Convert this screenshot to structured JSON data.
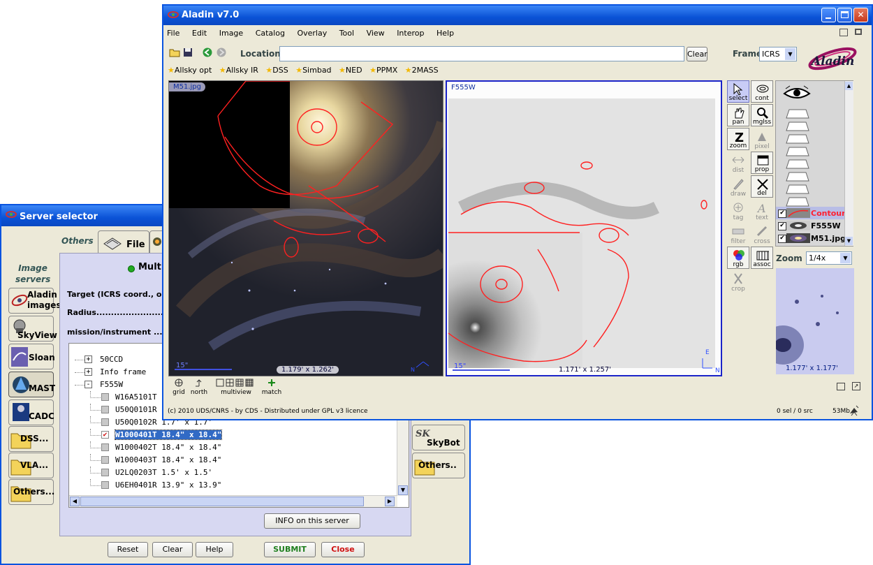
{
  "server_selector": {
    "title": "Server selector",
    "tabs": {
      "others_label": "Others",
      "file_label": "File"
    },
    "image_servers_label": "Image servers",
    "servers": [
      {
        "label": "Aladin images",
        "icon": "aladin-logo-icon"
      },
      {
        "label": "SkyView",
        "icon": "telescope-icon"
      },
      {
        "label": "Sloan",
        "icon": "sloan-logo-icon"
      },
      {
        "label": "MAST",
        "icon": "mast-logo-icon"
      },
      {
        "label": "CADC",
        "icon": "cadc-logo-icon"
      },
      {
        "label": "DSS...",
        "icon": "folder-icon"
      },
      {
        "label": "VLA...",
        "icon": "folder-icon"
      },
      {
        "label": "Others...",
        "icon": "folder-icon"
      }
    ],
    "right_servers": [
      {
        "label": "SkyBot",
        "icon": "skybot-logo-icon"
      },
      {
        "label": "Others..",
        "icon": "folder-icon"
      }
    ],
    "panel_title": "Multi",
    "form": {
      "target_label": "Target (ICRS coord., obj.",
      "radius_label": "Radius...............................",
      "mission_label": "mission/instrument ......."
    },
    "tree": [
      {
        "level": 0,
        "toggle": "+",
        "text": "50CCD"
      },
      {
        "level": 0,
        "toggle": "+",
        "text": "Info frame"
      },
      {
        "level": 0,
        "toggle": "-",
        "text": "F555W"
      },
      {
        "level": 1,
        "check": false,
        "text": "W16A5101T"
      },
      {
        "level": 1,
        "check": false,
        "text": "U50Q0101R"
      },
      {
        "level": 1,
        "check": false,
        "text": "U50Q0102R 1.7' x 1.7'"
      },
      {
        "level": 1,
        "check": true,
        "selected": true,
        "text": "W1000401T 18.4\" x 18.4\""
      },
      {
        "level": 1,
        "check": false,
        "text": "W1000402T 18.4\" x 18.4\""
      },
      {
        "level": 1,
        "check": false,
        "text": "W1000403T 18.4\" x 18.4\""
      },
      {
        "level": 1,
        "check": false,
        "text": "U2LQ0203T 1.5' x 1.5'"
      },
      {
        "level": 1,
        "check": false,
        "text": "U6EH0401R 13.9\" x 13.9\""
      }
    ],
    "info_button": "INFO on this server",
    "buttons": {
      "reset": "Reset",
      "clear": "Clear",
      "help": "Help",
      "submit": "SUBMIT",
      "close": "Close"
    }
  },
  "aladin": {
    "title": "Aladin v7.0",
    "menu": [
      "File",
      "Edit",
      "Image",
      "Catalog",
      "Overlay",
      "Tool",
      "View",
      "Interop",
      "Help"
    ],
    "location_label": "Location",
    "location_value": "",
    "clear_label": "Clear",
    "frame_label": "Frame",
    "frame_value": "ICRS",
    "logo_text": "Aladin",
    "bookmarks": [
      "Allsky opt",
      "Allsky IR",
      "DSS",
      "Simbad",
      "NED",
      "PPMX",
      "2MASS"
    ],
    "views": [
      {
        "label": "M51.jpg",
        "fov": "1.179' x 1.262'",
        "scale": "15\""
      },
      {
        "label": "F555W",
        "fov": "1.171' x 1.257'",
        "scale": "15\""
      }
    ],
    "compass": {
      "north": "N",
      "east": "E"
    },
    "bottom_tools": [
      "grid",
      "north",
      "multiview",
      "match"
    ],
    "toolbar": [
      {
        "label": "select",
        "state": "on"
      },
      {
        "label": "cont",
        "state": "normal"
      },
      {
        "label": "pan",
        "state": "normal"
      },
      {
        "label": "mglss",
        "state": "normal"
      },
      {
        "label": "zoom",
        "state": "normal"
      },
      {
        "label": "pixel",
        "state": "disabled"
      },
      {
        "label": "dist",
        "state": "disabled"
      },
      {
        "label": "prop",
        "state": "normal"
      },
      {
        "label": "draw",
        "state": "disabled"
      },
      {
        "label": "del",
        "state": "normal"
      },
      {
        "label": "tag",
        "state": "disabled"
      },
      {
        "label": "text",
        "state": "disabled"
      },
      {
        "label": "filter",
        "state": "disabled"
      },
      {
        "label": "cross",
        "state": "disabled"
      },
      {
        "label": "rgb",
        "state": "normal"
      },
      {
        "label": "assoc",
        "state": "normal"
      },
      {
        "label": "crop",
        "state": "disabled"
      }
    ],
    "layers": [
      {
        "label": "Contours",
        "checked": true,
        "highlight": true
      },
      {
        "label": "F555W",
        "checked": true,
        "highlight": false
      },
      {
        "label": "M51.jpg",
        "checked": true,
        "highlight": false
      }
    ],
    "zoom_label": "Zoom",
    "zoom_value": "1/4x",
    "zoom_fov": "1.177' x 1.177'",
    "copyright": "(c) 2010 UDS/CNRS - by CDS - Distributed under GPL v3 licence",
    "status": "0 sel / 0 src",
    "memory": "53Mb",
    "colors": {
      "title_blue": "#0a54e0",
      "contour_red": "#ff2020",
      "highlight": "#ff2030",
      "selection_blue": "#316ac5"
    }
  }
}
